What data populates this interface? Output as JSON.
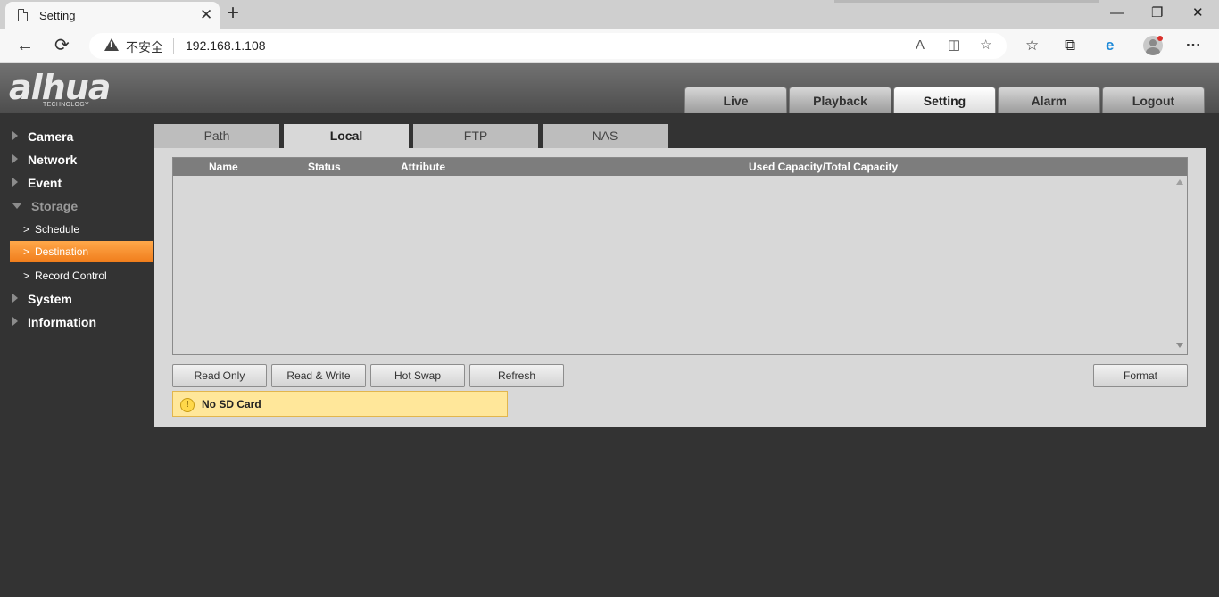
{
  "browser": {
    "tab_title": "Setting",
    "tab_close": "✕",
    "new_tab": "+",
    "window_controls": {
      "minimize": "—",
      "restore": "❐",
      "close": "✕"
    },
    "nav": {
      "back": "←",
      "refresh": "⟳"
    },
    "security_label": "不安全",
    "url": "192.168.1.108",
    "icons": [
      "read-aloud-icon",
      "split-screen-icon",
      "add-favorite-icon",
      "favorites-icon",
      "collections-icon",
      "edge-icon",
      "profile-icon",
      "more-icon"
    ],
    "icon_glyphs": {
      "read_aloud": "A",
      "split": "◫",
      "add_fav": "☆",
      "favorites": "☆",
      "collections": "⧉",
      "edge": "e",
      "more": "···"
    }
  },
  "app": {
    "logo": "alhua",
    "logo_sub": "TECHNOLOGY",
    "main_tabs": [
      "Live",
      "Playback",
      "Setting",
      "Alarm",
      "Logout"
    ],
    "active_main_tab": "Setting"
  },
  "sidebar": {
    "groups": [
      {
        "label": "Camera"
      },
      {
        "label": "Network"
      },
      {
        "label": "Event"
      },
      {
        "label": "Storage"
      },
      {
        "label": "System"
      },
      {
        "label": "Information"
      }
    ],
    "storage_items": [
      {
        "label": "Schedule"
      },
      {
        "label": "Destination"
      },
      {
        "label": "Record Control"
      }
    ],
    "active_item": "Destination"
  },
  "content": {
    "subtabs": [
      "Path",
      "Local",
      "FTP",
      "NAS"
    ],
    "active_subtab": "Local",
    "table": {
      "columns": [
        "Name",
        "Status",
        "Attribute",
        "Used Capacity/Total Capacity"
      ],
      "rows": []
    },
    "buttons": {
      "read_only": "Read Only",
      "read_write": "Read & Write",
      "hot_swap": "Hot Swap",
      "refresh": "Refresh",
      "format": "Format"
    },
    "notice": "No SD Card",
    "notice_icon": "!"
  },
  "colors": {
    "accent": "#f28a24",
    "notice_bg": "#ffe79a",
    "page_bg": "#333333"
  }
}
